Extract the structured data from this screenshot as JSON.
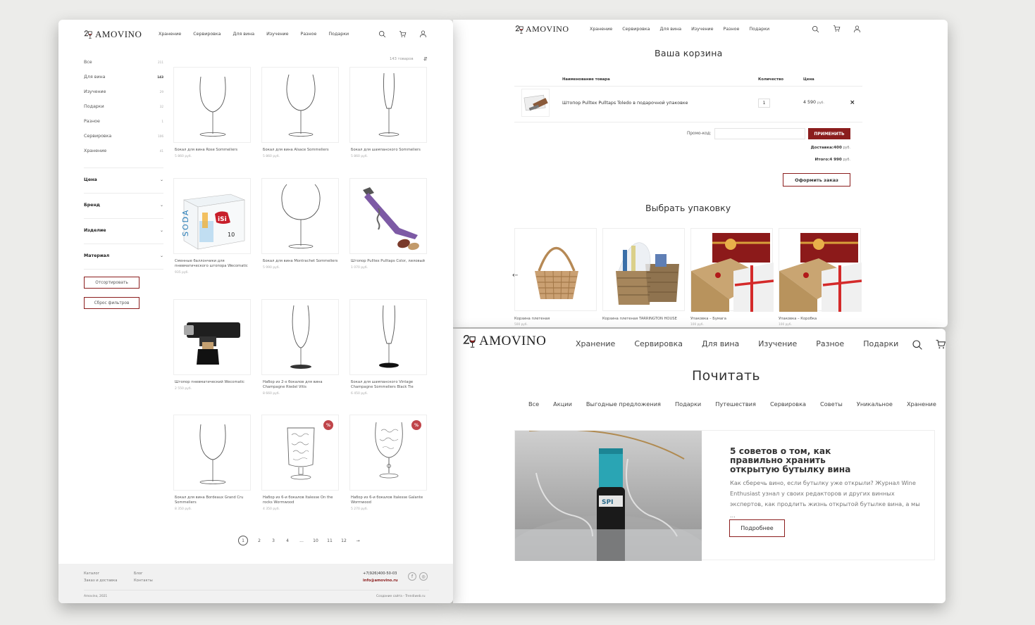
{
  "brand": {
    "logo_text": "AMOVINO",
    "accent_color": "#8b1d1d"
  },
  "nav_items": [
    "Хранение",
    "Сервировка",
    "Для вина",
    "Изучение",
    "Разное",
    "Подарки"
  ],
  "icons": [
    "search-icon",
    "cart-icon",
    "user-icon"
  ],
  "catalog": {
    "categories": [
      {
        "label": "Все",
        "count": "211"
      },
      {
        "label": "Для вина",
        "count": "143"
      },
      {
        "label": "Изучение",
        "count": "29"
      },
      {
        "label": "Подарки",
        "count": "32"
      },
      {
        "label": "Разное",
        "count": "1"
      },
      {
        "label": "Сервировка",
        "count": "106"
      },
      {
        "label": "Хранение",
        "count": "41"
      }
    ],
    "filters": [
      "Цена",
      "Бренд",
      "Изделие",
      "Материал"
    ],
    "sort_button": "Отсортировать",
    "reset_button": "Сброс фильтров",
    "count_label": "143 товаров",
    "products": [
      {
        "name": "Бокал для вина Rose Sommeliers",
        "price": "5 860 руб."
      },
      {
        "name": "Бокал для вина Alsace Sommeliers",
        "price": "5 860 руб."
      },
      {
        "name": "Бокал для шампанского Sommeliers",
        "price": "5 860 руб."
      },
      {
        "name": "Сменные баллончики для пневматического штопора Wecomatic",
        "price": "935 руб."
      },
      {
        "name": "Бокал для вина Montrachet Sommeliers",
        "price": "5 990 руб."
      },
      {
        "name": "Штопор Pulltex Pulltaps Color, лиловый",
        "price": "1 070 руб."
      },
      {
        "name": "Штопор пневматический Wecomatic",
        "price": "2 550 руб."
      },
      {
        "name": "Набор из 2-х бокалов для вина Champagne Riedel Vitis",
        "price": "8 660 руб."
      },
      {
        "name": "Бокал для шампанского Vintage Champagne Sommeliers Black Tie",
        "price": "6 450 руб."
      },
      {
        "name": "Бокал для вина Bordeaux Grand Cru Sommeliers",
        "price": "8 350 руб."
      },
      {
        "name": "Набор из 6-и бокалов Italesse On the rocks Wormwood",
        "price": "4 350 руб.",
        "sale": "%"
      },
      {
        "name": "Набор из 6-и бокалов Italesse Galante Wormwood",
        "price": "5 270 руб.",
        "sale": "%"
      }
    ],
    "pagination": [
      "1",
      "2",
      "3",
      "4",
      "...",
      "10",
      "11",
      "12",
      "→"
    ],
    "footer": {
      "col1": [
        "Каталог",
        "Заказ и доставка"
      ],
      "col2": [
        "Блог",
        "Контакты"
      ],
      "phone": "+7(926)400-50-03",
      "email": "info@amovino.ru",
      "copyright": "Amovino, 2021",
      "credit": "Создание сайта - Trendiweb.ru"
    }
  },
  "cart": {
    "title": "Ваша корзина",
    "col_name": "Наименование товара",
    "col_qty": "Количество",
    "col_price": "Цена",
    "item_name": "Штопор Pulltex Pulltaps Toledo в подарочной упаковке",
    "item_qty": "1",
    "item_price": "4 590",
    "currency": "руб.",
    "remove": "×",
    "promo_label": "Промо-код:",
    "apply": "ПРИМЕНИТЬ",
    "delivery_label": "Доставка:",
    "delivery_value": "400",
    "total_label": "Итого:",
    "total_value": "4 990",
    "order_button": "Оформить заказ",
    "pack_title": "Выбрать упаковку",
    "packs": [
      {
        "name": "Корзина плетеная",
        "price": "500 руб."
      },
      {
        "name": "Корзина плетеная TARRINGTON HOUSE",
        "price": ""
      },
      {
        "name": "Упаковка – Бумага",
        "price": "100 руб."
      },
      {
        "name": "Упаковка – Коробка",
        "price": "100 руб."
      }
    ]
  },
  "blog": {
    "title": "Почитать",
    "tags": [
      "Все",
      "Акции",
      "Выгодные предложения",
      "Подарки",
      "Путешествия",
      "Сервировка",
      "Советы",
      "Уникальное",
      "Хранение"
    ],
    "article_title": "5 советов о том, как правильно хранить открытую бутылку вина",
    "article_text": "Как сберечь вино, если бутылку уже открыли? Журнал Wine Enthusiast узнал у своих редакторов и других винных экспертов, как продлить жизнь открытой бутылке вина, а мы ...",
    "more_button": "Подробнее",
    "bottle_label": "SPI"
  }
}
